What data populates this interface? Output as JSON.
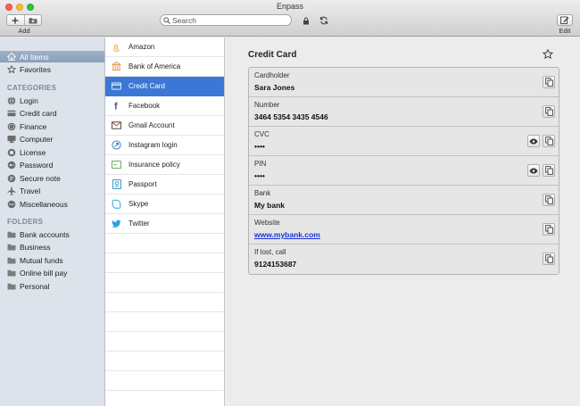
{
  "window": {
    "title": "Enpass"
  },
  "toolbar": {
    "add_label": "Add",
    "edit_label": "Edit",
    "search_placeholder": "Search"
  },
  "sidebar": {
    "all_items": "All Items",
    "favorites": "Favorites",
    "categories_heading": "CATEGORIES",
    "categories": [
      {
        "label": "Login",
        "icon": "globe-icon"
      },
      {
        "label": "Credit card",
        "icon": "credit-card-icon"
      },
      {
        "label": "Finance",
        "icon": "coins-icon"
      },
      {
        "label": "Computer",
        "icon": "computer-icon"
      },
      {
        "label": "License",
        "icon": "license-icon"
      },
      {
        "label": "Password",
        "icon": "key-icon"
      },
      {
        "label": "Secure note",
        "icon": "note-icon"
      },
      {
        "label": "Travel",
        "icon": "plane-icon"
      },
      {
        "label": "Miscellaneous",
        "icon": "misc-icon"
      }
    ],
    "folders_heading": "FOLDERS",
    "folders": [
      {
        "label": "Bank accounts",
        "icon": "folder-icon"
      },
      {
        "label": "Business",
        "icon": "folder-icon"
      },
      {
        "label": "Mutual funds",
        "icon": "folder-icon"
      },
      {
        "label": "Online bill pay",
        "icon": "folder-icon"
      },
      {
        "label": "Personal",
        "icon": "folder-icon"
      }
    ]
  },
  "items": [
    {
      "label": "Amazon",
      "icon": "amazon-icon",
      "color": "#f39a1f"
    },
    {
      "label": "Bank of America",
      "icon": "bank-icon",
      "color": "#e6843a"
    },
    {
      "label": "Credit Card",
      "icon": "credit-card-icon",
      "color": "#ffffff",
      "selected": true
    },
    {
      "label": "Facebook",
      "icon": "facebook-icon",
      "color": "#3b5998"
    },
    {
      "label": "Gmail Account",
      "icon": "gmail-icon",
      "color": "#333333"
    },
    {
      "label": "Instagram login",
      "icon": "instagram-icon",
      "color": "#2a78c2"
    },
    {
      "label": "Insurance policy",
      "icon": "insurance-icon",
      "color": "#5aa445"
    },
    {
      "label": "Passport",
      "icon": "passport-icon",
      "color": "#1f8fc9"
    },
    {
      "label": "Skype",
      "icon": "skype-icon",
      "color": "#1aa0e6"
    },
    {
      "label": "Twitter",
      "icon": "twitter-icon",
      "color": "#2da3e0"
    }
  ],
  "detail": {
    "title": "Credit Card",
    "fields": [
      {
        "label": "Cardholder",
        "value": "Sara Jones",
        "hidden": false,
        "link": false
      },
      {
        "label": "Number",
        "value": "3464 5354 3435 4546",
        "hidden": false,
        "link": false
      },
      {
        "label": "CVC",
        "value": "••••",
        "hidden": true,
        "link": false
      },
      {
        "label": "PIN",
        "value": "••••",
        "hidden": true,
        "link": false
      },
      {
        "label": "Bank",
        "value": "My bank",
        "hidden": false,
        "link": false
      },
      {
        "label": "Website",
        "value": "www.mybank.com",
        "hidden": false,
        "link": true
      },
      {
        "label": "If lost, call",
        "value": "9124153687",
        "hidden": false,
        "link": false
      }
    ]
  },
  "colors": {
    "selection": "#3b78d6",
    "sidebar_bg": "#dde3ea",
    "link": "#1a34d6"
  }
}
